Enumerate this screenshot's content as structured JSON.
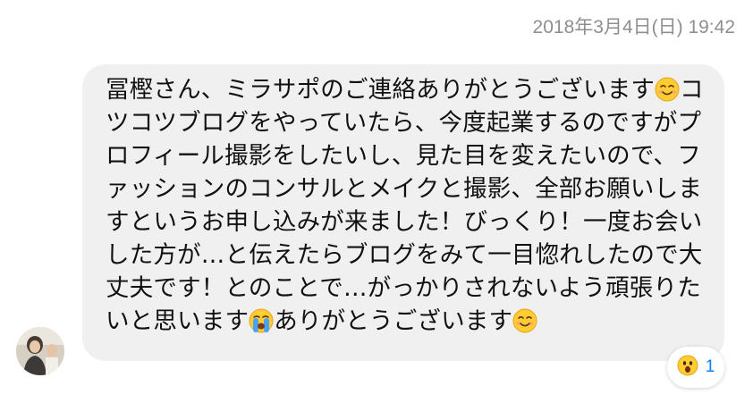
{
  "timestamp": "2018年3月4日(日) 19:42",
  "message": {
    "segments": [
      {
        "text": "冨樫さん、ミラサポのご連絡ありがとうございます"
      },
      {
        "emoji": "smiling-face-icon"
      },
      {
        "text": "コツコツブログをやっていたら、今度起業するのですがプロフィール撮影をしたいし、見た目を変えたいので、ファッションのコンサルとメイクと撮影、全部お願いしますというお申し込みが来ました！びっくり！一度お会いした方が…と伝えたらブログをみて一目惚れしたので大丈夫です！とのことで…がっかりされないよう頑張りたいと思います"
      },
      {
        "emoji": "crying-face-icon"
      },
      {
        "text": "ありがとうございます"
      },
      {
        "emoji": "smiling-face-icon"
      }
    ]
  },
  "reaction": {
    "icon": "surprised-face-icon",
    "count": "1"
  },
  "colors": {
    "bubble": "#f0f0f1",
    "timestamp": "#8e8e93",
    "reaction_count": "#0a7cff"
  }
}
